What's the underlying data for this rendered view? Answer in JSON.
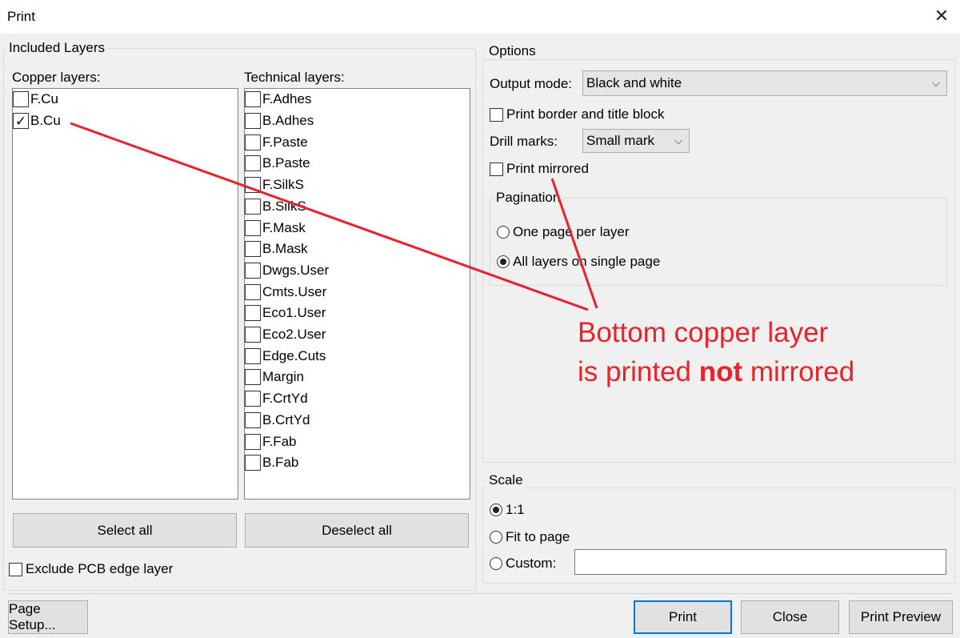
{
  "window": {
    "title": "Print",
    "close_glyph": "✕"
  },
  "included_layers": {
    "label": "Included Layers",
    "copper": {
      "label": "Copper layers:",
      "items": [
        {
          "label": "F.Cu",
          "checked": false
        },
        {
          "label": "B.Cu",
          "checked": true
        }
      ]
    },
    "technical": {
      "label": "Technical layers:",
      "items": [
        {
          "label": "F.Adhes",
          "checked": false
        },
        {
          "label": "B.Adhes",
          "checked": false
        },
        {
          "label": "F.Paste",
          "checked": false
        },
        {
          "label": "B.Paste",
          "checked": false
        },
        {
          "label": "F.SilkS",
          "checked": false
        },
        {
          "label": "B.SilkS",
          "checked": false
        },
        {
          "label": "F.Mask",
          "checked": false
        },
        {
          "label": "B.Mask",
          "checked": false
        },
        {
          "label": "Dwgs.User",
          "checked": false
        },
        {
          "label": "Cmts.User",
          "checked": false
        },
        {
          "label": "Eco1.User",
          "checked": false
        },
        {
          "label": "Eco2.User",
          "checked": false
        },
        {
          "label": "Edge.Cuts",
          "checked": false
        },
        {
          "label": "Margin",
          "checked": false
        },
        {
          "label": "F.CrtYd",
          "checked": false
        },
        {
          "label": "B.CrtYd",
          "checked": false
        },
        {
          "label": "F.Fab",
          "checked": false
        },
        {
          "label": "B.Fab",
          "checked": false
        }
      ]
    },
    "select_all": "Select all",
    "deselect_all": "Deselect all",
    "exclude_edge": {
      "label": "Exclude PCB edge layer",
      "checked": false
    }
  },
  "options": {
    "label": "Options",
    "output_mode_label": "Output mode:",
    "output_mode_value": "Black and white",
    "print_border": {
      "label": "Print border and title block",
      "checked": false
    },
    "drill_marks_label": "Drill marks:",
    "drill_marks_value": "Small mark",
    "print_mirrored": {
      "label": "Print mirrored",
      "checked": false
    },
    "pagination": {
      "label": "Pagination",
      "one_per_layer": "One page per layer",
      "single_page": "All layers on single page",
      "selected": "single_page"
    }
  },
  "scale": {
    "label": "Scale",
    "one_to_one": "1:1",
    "fit_to_page": "Fit to page",
    "custom": "Custom:",
    "custom_value": "",
    "selected": "one_to_one"
  },
  "annotation": {
    "line1": "Bottom copper layer",
    "line2_pre": "is printed ",
    "line2_bold": "not",
    "line2_post": " mirrored",
    "color": "#e8232b"
  },
  "footer": {
    "page_setup": "Page Setup...",
    "print": "Print",
    "close": "Close",
    "print_preview": "Print Preview"
  },
  "icons": {
    "checkmark": "✓",
    "chevron": "⌵"
  }
}
